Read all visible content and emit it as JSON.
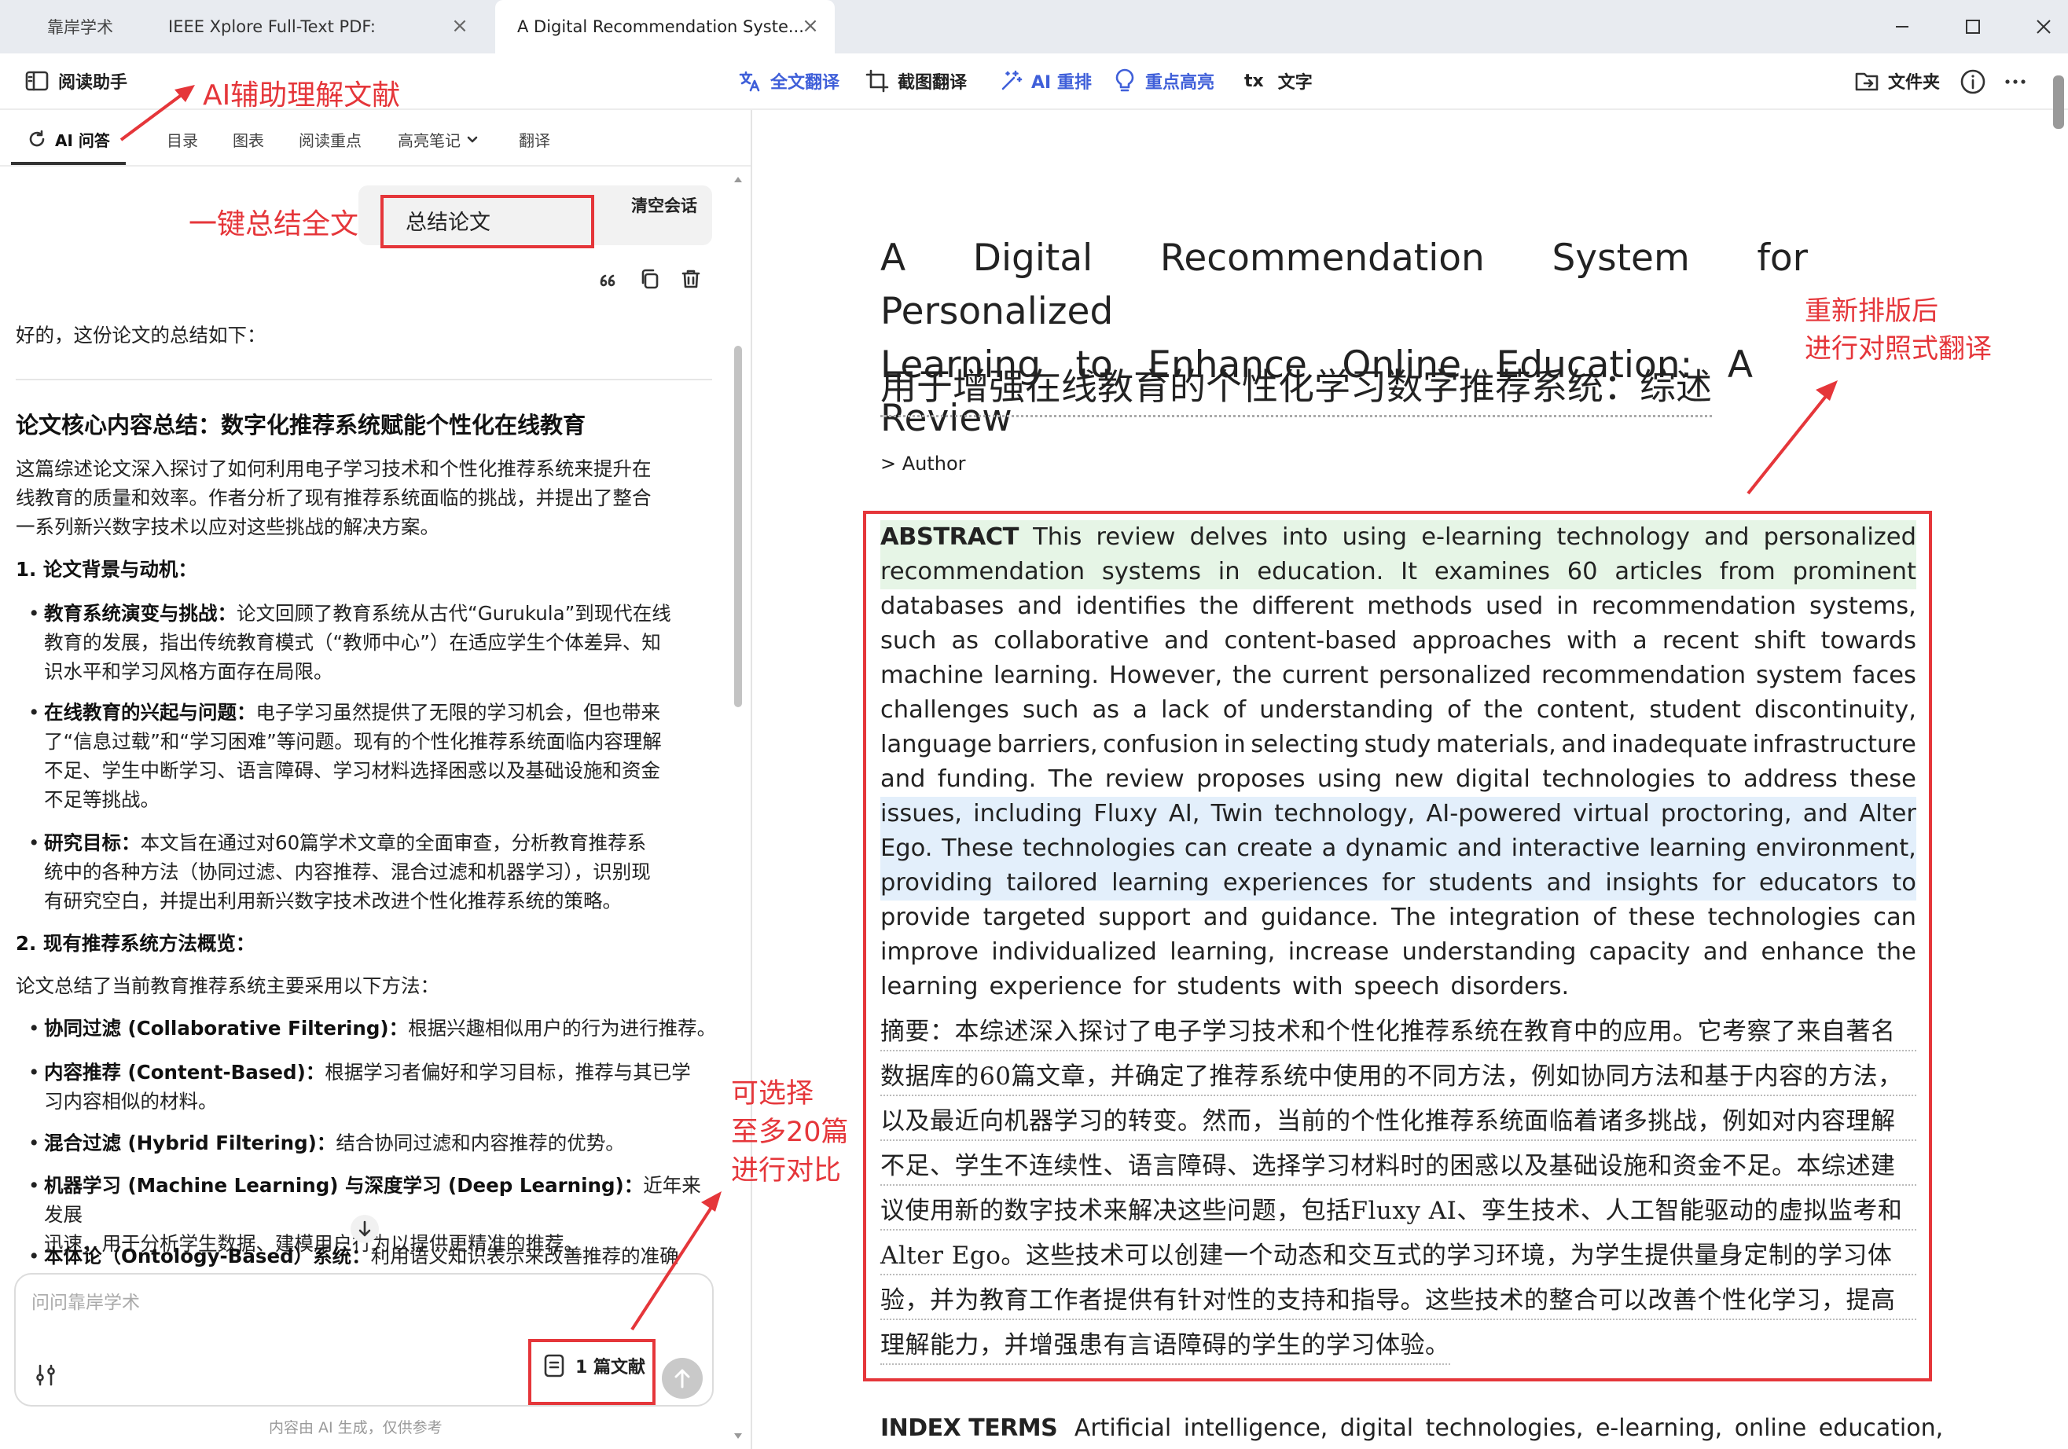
{
  "tabs": [
    {
      "label": "靠岸学术"
    },
    {
      "label": "IEEE Xplore Full-Text PDF:"
    },
    {
      "label": "A Digital Recommendation Syste..."
    }
  ],
  "toolbar": {
    "reading_assistant": "阅读助手",
    "full_translate": "全文翻译",
    "screenshot_translate": "截图翻译",
    "ai_reflow": "AI 重排",
    "highlight": "重点高亮",
    "text_glyph": "tx",
    "text": "文字",
    "folder": "文件夹"
  },
  "left_tabs": {
    "ai_qa": "AI 问答",
    "toc": "目录",
    "charts": "图表",
    "key_points": "阅读重点",
    "notes": "高亮笔记",
    "translate": "翻译"
  },
  "chat": {
    "summary_chip": "总结论文",
    "clear_chat": "清空会话",
    "intro": "好的，这份论文的总结如下：",
    "heading": "论文核心内容总结：数字化推荐系统赋能个性化在线教育",
    "para1_lines": [
      "这篇综述论文深入探讨了如何利用电子学习技术和个性化推荐系统来提升在",
      "线教育的质量和效率。作者分析了现有推荐系统面临的挑战，并提出了整合",
      "一系列新兴数字技术以应对这些挑战的解决方案。"
    ],
    "section1": "1. 论文背景与动机：",
    "bullets1": [
      {
        "bold": "教育系统演变与挑战：",
        "lines": [
          "论文回顾了教育系统从古代“Gurukula”到现代在线",
          "教育的发展，指出传统教育模式（“教师中心”）在适应学生个体差异、知",
          "识水平和学习风格方面存在局限。"
        ]
      },
      {
        "bold": "在线教育的兴起与问题：",
        "lines": [
          "电子学习虽然提供了无限的学习机会，但也带来",
          "了“信息过载”和“学习困难”等问题。现有的个性化推荐系统面临内容理解",
          "不足、学生中断学习、语言障碍、学习材料选择困惑以及基础设施和资金",
          "不足等挑战。"
        ]
      },
      {
        "bold": "研究目标：",
        "lines": [
          "本文旨在通过对60篇学术文章的全面审查，分析教育推荐系",
          "统中的各种方法（协同过滤、内容推荐、混合过滤和机器学习），识别现",
          "有研究空白，并提出利用新兴数字技术改进个性化推荐系统的策略。"
        ]
      }
    ],
    "section2": "2. 现有推荐系统方法概览：",
    "section2_intro": "论文总结了当前教育推荐系统主要采用以下方法：",
    "bullets2": [
      {
        "bold": "协同过滤 (Collaborative Filtering)：",
        "lines": [
          "根据兴趣相似用户的行为进行推荐。"
        ]
      },
      {
        "bold": "内容推荐 (Content-Based)：",
        "lines": [
          "根据学习者偏好和学习目标，推荐与其已学",
          "习内容相似的材料。"
        ]
      },
      {
        "bold": "混合过滤 (Hybrid Filtering)：",
        "lines": [
          "结合协同过滤和内容推荐的优势。"
        ]
      },
      {
        "bold": "机器学习 (Machine Learning) 与深度学习 (Deep Learning)：",
        "lines": [
          "近年来发展",
          "迅速，用于分析学生数据、建模用户行为以提供更精准的推荐。"
        ]
      },
      {
        "bold": "本体论（Ontology-Based）系统：",
        "lines": [
          "利用语义知识表示来改善推荐的准确"
        ]
      }
    ],
    "input_placeholder": "问问靠岸学术",
    "doc_count": "1 篇文献",
    "ai_note": "内容由 AI 生成，仅供参考"
  },
  "annotations": {
    "ai_assist": "AI辅助理解文献",
    "one_click": "一键总结全文",
    "reflow": [
      "重新排版后",
      "进行对照式翻译"
    ],
    "compare": [
      "可选择",
      "至多20篇",
      "进行对比"
    ]
  },
  "document": {
    "title_en": [
      "A Digital Recommendation System for Personalized",
      "Learning to Enhance Online Education: A Review"
    ],
    "title_zh": "用于增强在线教育的个性化学习数字推荐系统：综述",
    "author_toggle": ">  Author",
    "abstract_label": "ABSTRACT",
    "abstract_lines": [
      {
        "hl": "green",
        "text": "ABSTRACT This review delves into using e-learning technology and personalized"
      },
      {
        "hl": "green",
        "text": "recommendation systems in education. It examines 60 articles from prominent"
      },
      {
        "hl": "",
        "text": "databases and identifies the different methods used in recommendation systems,"
      },
      {
        "hl": "",
        "text": "such as collaborative and content-based approaches with a recent shift towards"
      },
      {
        "hl": "",
        "text": "machine learning. However, the current personalized recommendation system faces"
      },
      {
        "hl": "",
        "text": "challenges such as a lack of understanding of the content, student discontinuity,"
      },
      {
        "hl": "",
        "text": "language barriers, confusion in selecting study materials, and inadequate infrastructure"
      },
      {
        "hl": "",
        "text": "and funding. The review proposes using new digital technologies to address these"
      },
      {
        "hl": "blue",
        "text": "issues, including Fluxy AI, Twin technology, AI-powered virtual proctoring, and Alter"
      },
      {
        "hl": "blue",
        "text": "Ego. These technologies can create a dynamic and interactive learning environment,"
      },
      {
        "hl": "blue",
        "text": "providing tailored learning experiences for students and insights for educators to"
      },
      {
        "hl": "",
        "text": "provide targeted support and guidance. The integration of these technologies can"
      },
      {
        "hl": "",
        "text": "improve individualized learning, increase understanding capacity and enhance the"
      },
      {
        "hl": "",
        "text": "learning experience for students with speech disorders."
      }
    ],
    "abstract_zh_lines": [
      "摘要：本综述深入探讨了电子学习技术和个性化推荐系统在教育中的应用。它考察了来自著名",
      "数据库的60篇文章，并确定了推荐系统中使用的不同方法，例如协同方法和基于内容的方法，",
      "以及最近向机器学习的转变。然而，当前的个性化推荐系统面临着诸多挑战，例如对内容理解",
      "不足、学生不连续性、语言障碍、选择学习材料时的困惑以及基础设施和资金不足。本综述建",
      "议使用新的数字技术来解决这些问题，包括Fluxy AI、孪生技术、人工智能驱动的虚拟监考和",
      "Alter Ego。这些技术可以创建一个动态和交互式的学习环境，为学生提供量身定制的学习体",
      "验，并为教育工作者提供有针对性的支持和指导。这些技术的整合可以改善个性化学习，提高",
      "理解能力，并增强患有言语障碍的学生的学习体验。"
    ],
    "index_terms_label": "INDEX TERMS",
    "index_terms": "Artificial intelligence, digital technologies, e-learning, online education,"
  },
  "colors": {
    "accent_blue": "#3f5fd9",
    "annotation_red": "#e5363a",
    "highlight_green": "#e6f5e6",
    "highlight_blue": "#e3effb"
  }
}
